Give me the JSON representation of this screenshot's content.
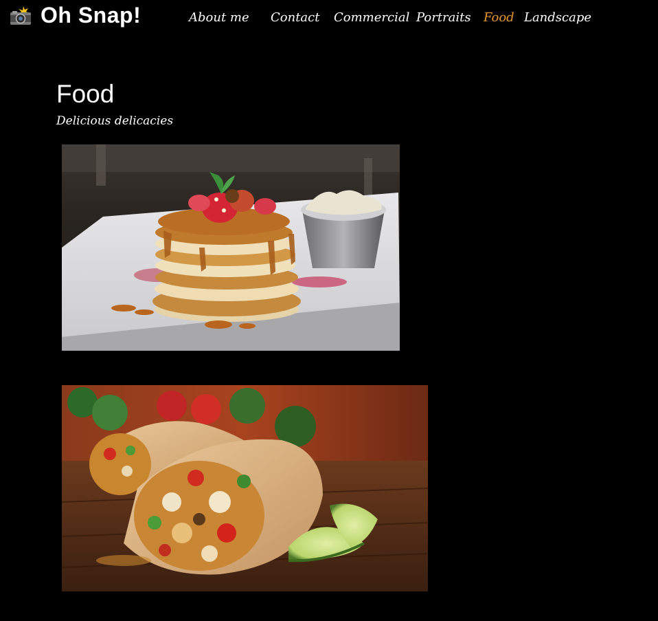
{
  "header": {
    "logo_icon": "camera-flash-icon",
    "title": "Oh Snap!"
  },
  "nav": {
    "items": [
      {
        "label": "About me",
        "active": false
      },
      {
        "label": "Contact",
        "active": false
      },
      {
        "label": "Commercial",
        "active": false
      },
      {
        "label": "Portraits",
        "active": false
      },
      {
        "label": "Food",
        "active": true
      },
      {
        "label": "Landscape",
        "active": false
      }
    ],
    "active_color": "#e8952c"
  },
  "main": {
    "title": "Food",
    "subtitle": "Delicious delicacies",
    "photos": [
      {
        "subject": "pancakes-with-caramel-and-strawberries"
      },
      {
        "subject": "burritos-with-lime"
      }
    ]
  },
  "colors": {
    "background": "#000000",
    "text": "#ffffff",
    "accent": "#e8952c"
  }
}
